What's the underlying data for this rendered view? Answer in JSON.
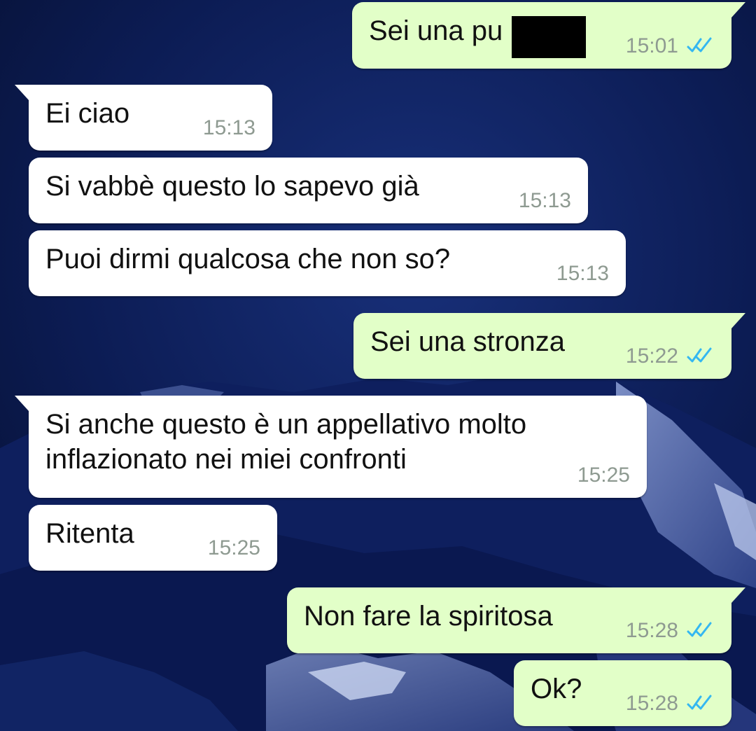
{
  "messages": [
    {
      "direction": "out",
      "text": "Sei una pu",
      "time": "15:01",
      "redacted": true
    },
    {
      "direction": "in",
      "text": "Ei ciao",
      "time": "15:13"
    },
    {
      "direction": "in",
      "text": "Si vabbè questo lo sapevo già",
      "time": "15:13"
    },
    {
      "direction": "in",
      "text": "Puoi dirmi qualcosa che non so?",
      "time": "15:13"
    },
    {
      "direction": "out",
      "text": "Sei una stronza",
      "time": "15:22"
    },
    {
      "direction": "in",
      "text": "Si anche questo è un appellativo molto\ninflazionato nei miei confronti",
      "time": "15:25"
    },
    {
      "direction": "in",
      "text": "Ritenta",
      "time": "15:25"
    },
    {
      "direction": "out",
      "text": "Non fare la spiritosa",
      "time": "15:28"
    },
    {
      "direction": "out",
      "text": "Ok?",
      "time": "15:28"
    }
  ],
  "icons": {
    "read_receipt": "double-check-icon"
  },
  "colors": {
    "incoming_bubble": "#ffffff",
    "outgoing_bubble": "#e2ffc8",
    "read_tick": "#34b7f1",
    "timestamp": "#8e9a91",
    "wallpaper_sky": "#061338"
  }
}
